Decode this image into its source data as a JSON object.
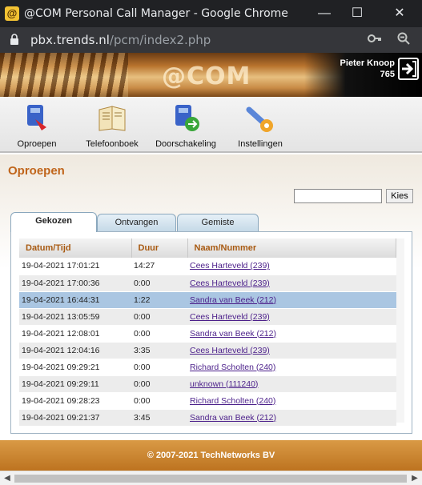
{
  "window": {
    "title": "@COM Personal Call Manager - Google Chrome",
    "minimize": "—",
    "maximize": "☐",
    "close": "✕"
  },
  "address": {
    "host": "pbx.trends.nl",
    "path": "/pcm/index2.php"
  },
  "banner": {
    "logo_text": "@COM",
    "user_name": "Pieter Knoop",
    "extension": "765"
  },
  "toolbar": {
    "items": [
      {
        "label": "Oproepen",
        "icon": "phone-icon"
      },
      {
        "label": "Telefoonboek",
        "icon": "phonebook-icon"
      },
      {
        "label": "Doorschakeling",
        "icon": "forward-icon"
      },
      {
        "label": "Instellingen",
        "icon": "settings-icon"
      }
    ]
  },
  "page": {
    "title": "Oproepen"
  },
  "search": {
    "value": "",
    "button": "Kies"
  },
  "tabs": [
    {
      "label": "Gekozen",
      "active": true
    },
    {
      "label": "Ontvangen"
    },
    {
      "label": "Gemiste"
    }
  ],
  "table": {
    "headers": [
      "Datum/Tijd",
      "Duur",
      "Naam/Nummer"
    ],
    "rows": [
      [
        "19-04-2021 17:01:21",
        "14:27",
        "Cees Harteveld (239)"
      ],
      [
        "19-04-2021 17:00:36",
        "0:00",
        "Cees Harteveld (239)"
      ],
      [
        "19-04-2021 16:44:31",
        "1:22",
        "Sandra van Beek (212)"
      ],
      [
        "19-04-2021 13:05:59",
        "0:00",
        "Cees Harteveld (239)"
      ],
      [
        "19-04-2021 12:08:01",
        "0:00",
        "Sandra van Beek (212)"
      ],
      [
        "19-04-2021 12:04:16",
        "3:35",
        "Cees Harteveld (239)"
      ],
      [
        "19-04-2021 09:29:21",
        "0:00",
        "Richard Scholten (240)"
      ],
      [
        "19-04-2021 09:29:11",
        "0:00",
        "unknown (111240)"
      ],
      [
        "19-04-2021 09:28:23",
        "0:00",
        "Richard Scholten (240)"
      ],
      [
        "19-04-2021 09:21:37",
        "3:45",
        "Sandra van Beek (212)"
      ]
    ],
    "selected_row": 2
  },
  "footer": {
    "text": "© 2007-2021 TechNetworks BV"
  },
  "colors": {
    "accent": "#c0651b",
    "selected_row": "#aac6e2",
    "footer": "#c97f2c",
    "link": "#4b1f8a"
  }
}
